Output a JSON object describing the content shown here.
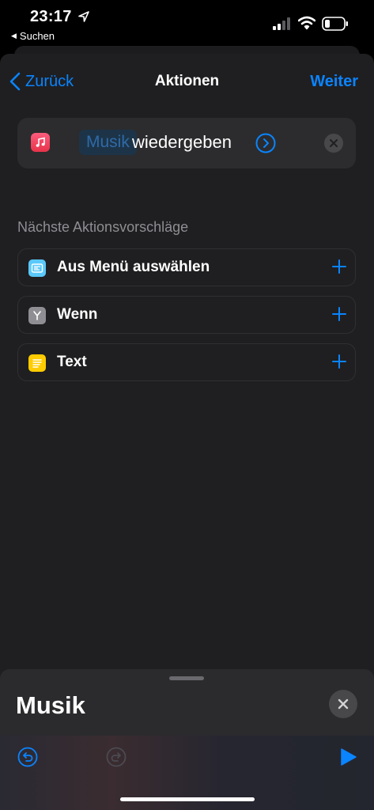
{
  "status_bar": {
    "time": "23:17",
    "back_app": "Suchen",
    "icons": [
      "location-arrow-icon",
      "cellular-signal-icon",
      "wifi-icon",
      "battery-icon"
    ]
  },
  "nav": {
    "back_label": "Zurück",
    "title": "Aktionen",
    "next_label": "Weiter"
  },
  "action": {
    "app_icon": "music-note-icon",
    "parameter": "Musik",
    "verb": "wiedergeben",
    "expand_icon": "chevron-circle-icon",
    "clear_icon": "clear-icon"
  },
  "suggestions": {
    "header": "Nächste Aktionsvorschläge",
    "items": [
      {
        "label": "Aus Menü auswählen",
        "icon": "menu-icon",
        "color": "#5ac8fa"
      },
      {
        "label": "Wenn",
        "icon": "branch-icon",
        "color": "#8e8e93"
      },
      {
        "label": "Text",
        "icon": "text-lines-icon",
        "color": "#ffcc00"
      }
    ]
  },
  "bottom_sheet": {
    "title": "Musik",
    "toolbar_icons": [
      "undo-icon",
      "redo-icon",
      "play-icon"
    ]
  },
  "colors": {
    "accent": "#0a84ff",
    "background": "#1f1f21",
    "card": "#2c2c2e"
  }
}
